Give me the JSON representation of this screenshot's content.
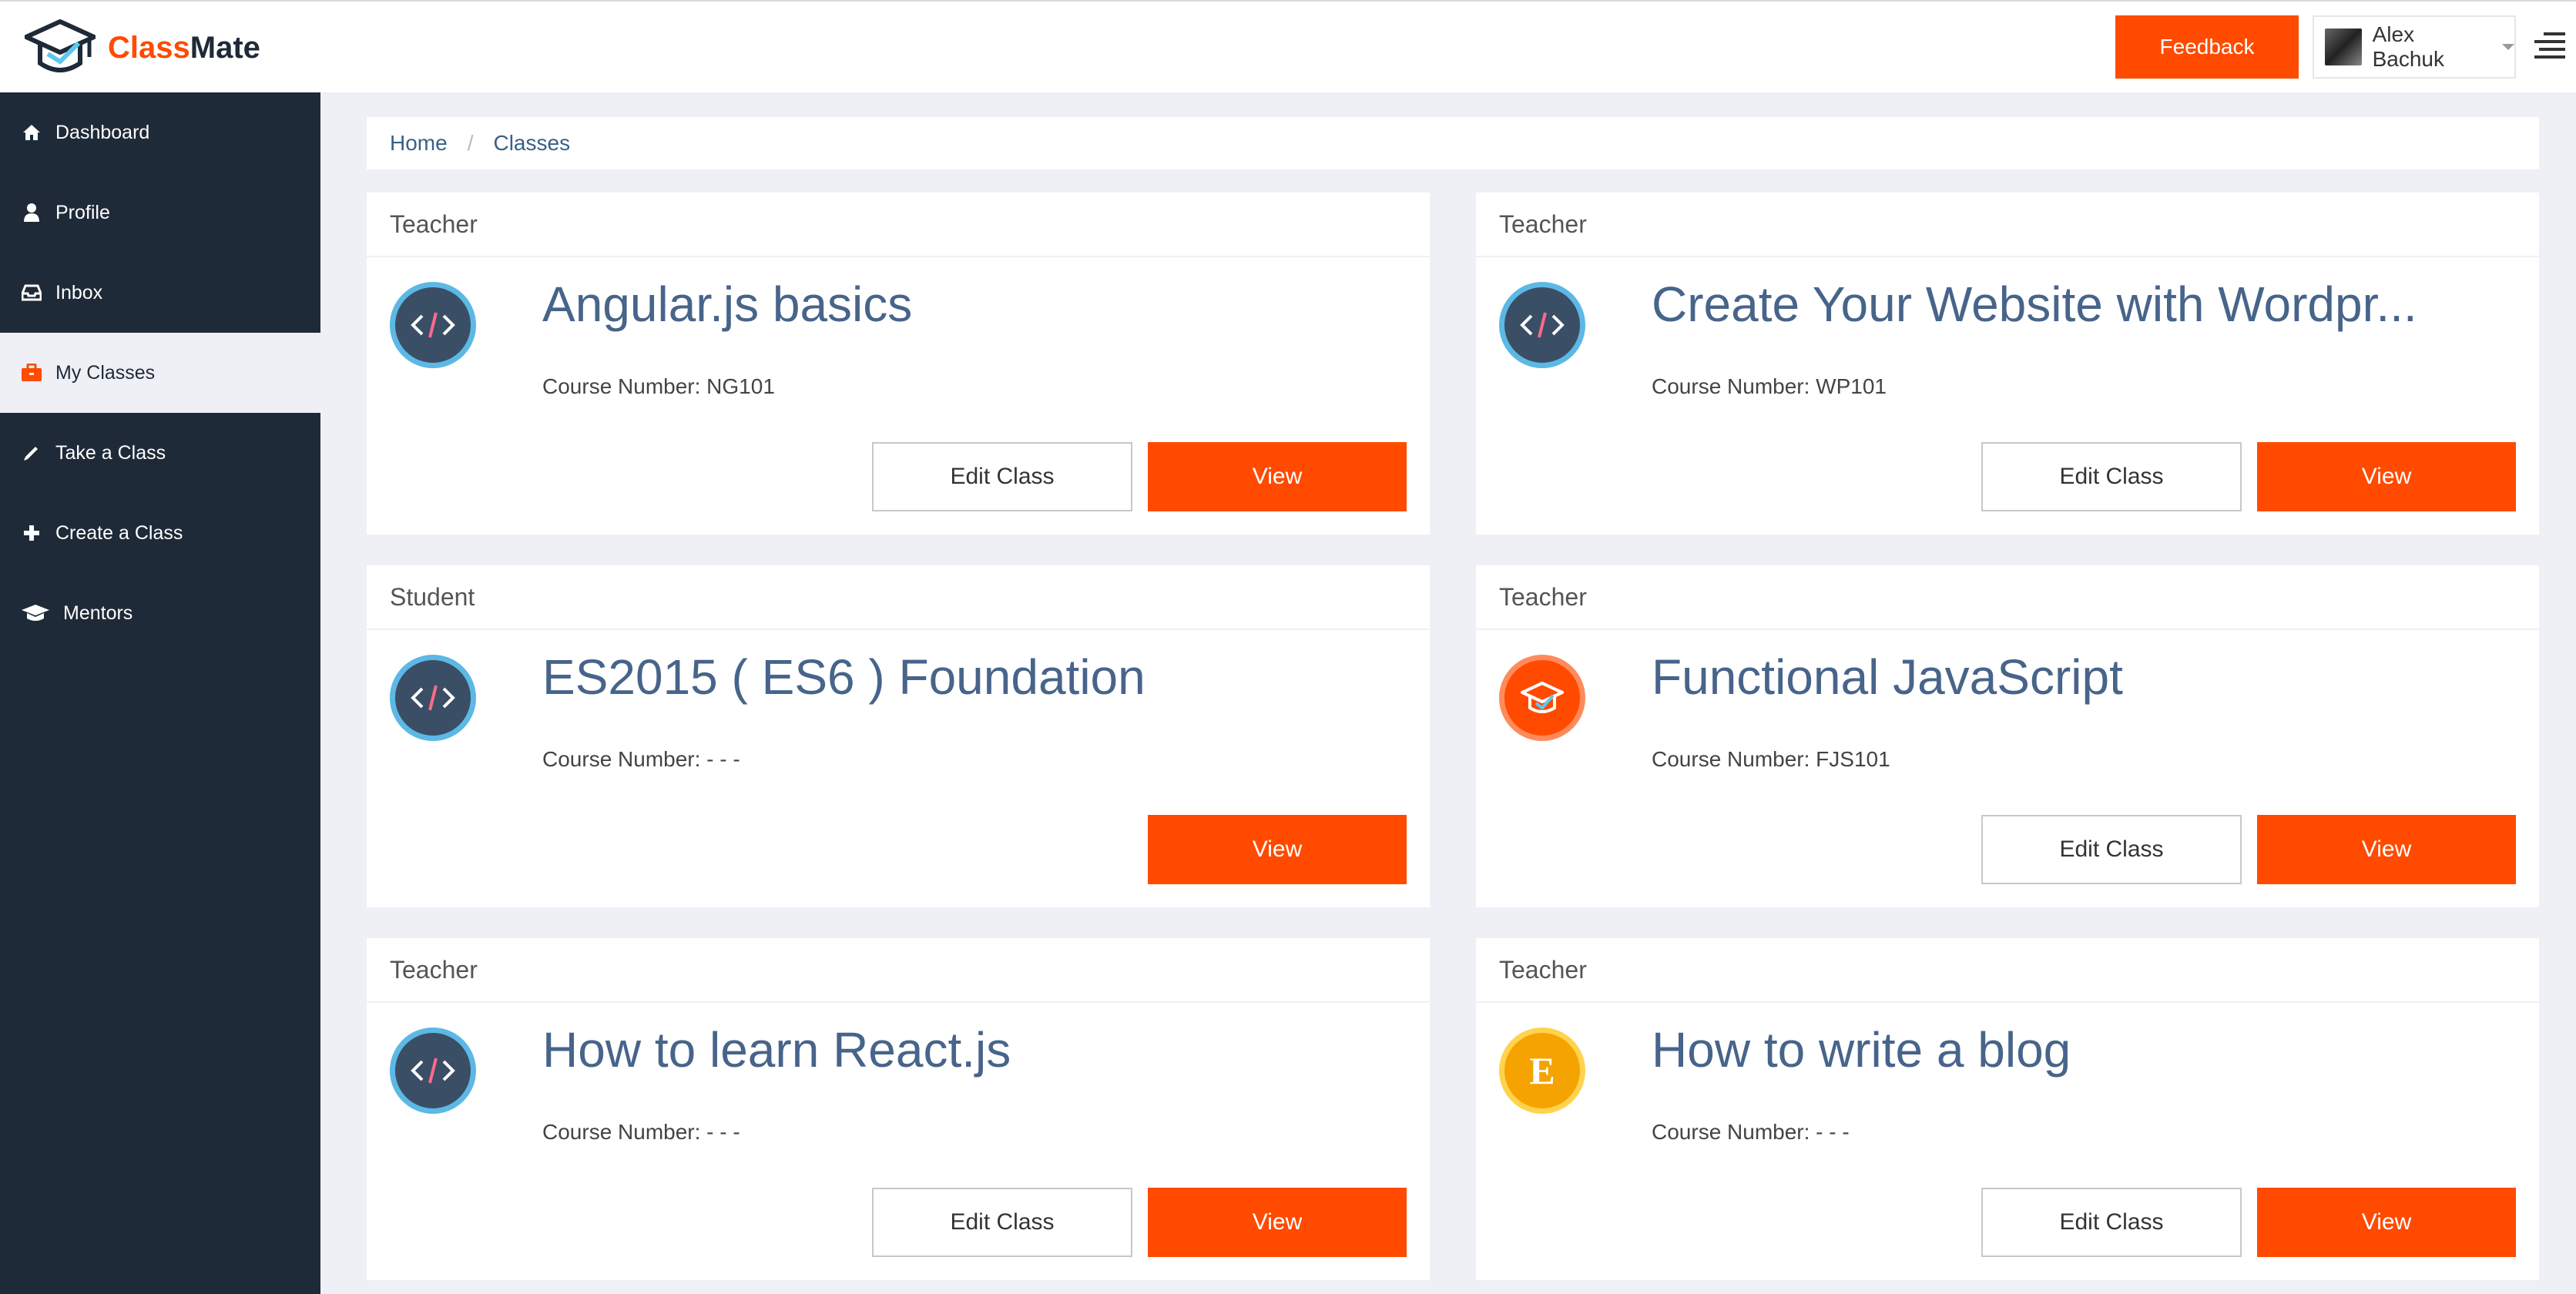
{
  "app": {
    "name_part1": "Class",
    "name_part2": "Mate",
    "brand_color": "#ff4a00",
    "sidebar_color": "#1f2a38"
  },
  "header": {
    "feedback_label": "Feedback",
    "user_name": "Alex Bachuk"
  },
  "sidebar": {
    "items": [
      {
        "label": "Dashboard",
        "icon": "home-icon",
        "active": false
      },
      {
        "label": "Profile",
        "icon": "user-icon",
        "active": false
      },
      {
        "label": "Inbox",
        "icon": "inbox-icon",
        "active": false
      },
      {
        "label": "My Classes",
        "icon": "briefcase-icon",
        "active": true
      },
      {
        "label": "Take a Class",
        "icon": "pencil-icon",
        "active": false
      },
      {
        "label": "Create a Class",
        "icon": "plus-icon",
        "active": false
      },
      {
        "label": "Mentors",
        "icon": "graduation-cap-icon",
        "active": false
      }
    ]
  },
  "breadcrumb": {
    "home": "Home",
    "separator": "/",
    "current": "Classes"
  },
  "classes": [
    {
      "role": "Teacher",
      "title": "Angular.js basics",
      "course": "Course Number: NG101",
      "icon": "code-icon",
      "edit_label": "Edit Class",
      "view_label": "View"
    },
    {
      "role": "Teacher",
      "title": "Create Your Website with Wordpr...",
      "course": "Course Number: WP101",
      "icon": "code-icon",
      "edit_label": "Edit Class",
      "view_label": "View"
    },
    {
      "role": "Student",
      "title": "ES2015 ( ES6 ) Foundation",
      "course": "Course Number: - - -",
      "icon": "code-icon",
      "view_label": "View"
    },
    {
      "role": "Teacher",
      "title": "Functional JavaScript",
      "course": "Course Number: FJS101",
      "icon": "graduation-cap-icon",
      "edit_label": "Edit Class",
      "view_label": "View"
    },
    {
      "role": "Teacher",
      "title": "How to learn React.js",
      "course": "Course Number: - - -",
      "icon": "code-icon",
      "edit_label": "Edit Class",
      "view_label": "View"
    },
    {
      "role": "Teacher",
      "title": "How to write a blog",
      "course": "Course Number: - - -",
      "icon": "letter-e-icon",
      "icon_letter": "E",
      "edit_label": "Edit Class",
      "view_label": "View"
    }
  ]
}
